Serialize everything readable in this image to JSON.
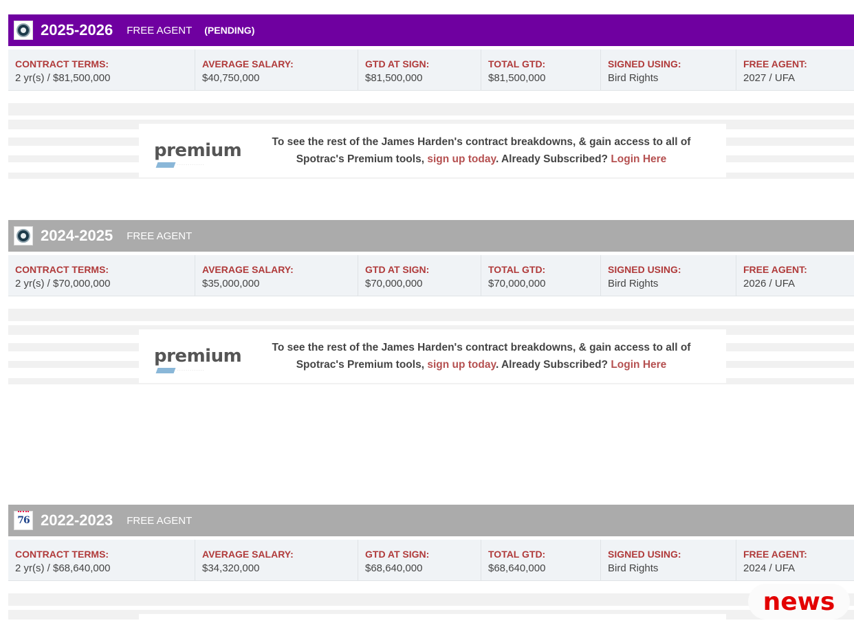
{
  "contracts": [
    {
      "season": "2025-2026",
      "status": "FREE AGENT",
      "pending": "(PENDING)",
      "team_logo": "team-logo-icon",
      "terms": [
        {
          "label": "CONTRACT TERMS:",
          "value": "2 yr(s) / $81,500,000"
        },
        {
          "label": "AVERAGE SALARY:",
          "value": "$40,750,000"
        },
        {
          "label": "GTD AT SIGN:",
          "value": "$81,500,000"
        },
        {
          "label": "TOTAL GTD:",
          "value": "$81,500,000"
        },
        {
          "label": "SIGNED USING:",
          "value": "Bird Rights"
        },
        {
          "label": "FREE AGENT:",
          "value": "2027 / UFA"
        }
      ]
    },
    {
      "season": "2024-2025",
      "status": "FREE AGENT",
      "team_logo": "team-logo-icon",
      "terms": [
        {
          "label": "CONTRACT TERMS:",
          "value": "2 yr(s) / $70,000,000"
        },
        {
          "label": "AVERAGE SALARY:",
          "value": "$35,000,000"
        },
        {
          "label": "GTD AT SIGN:",
          "value": "$70,000,000"
        },
        {
          "label": "TOTAL GTD:",
          "value": "$70,000,000"
        },
        {
          "label": "SIGNED USING:",
          "value": "Bird Rights"
        },
        {
          "label": "FREE AGENT:",
          "value": "2026 / UFA"
        }
      ]
    },
    {
      "season": "2022-2023",
      "status": "FREE AGENT",
      "team_logo": "sixers-logo-icon",
      "team_logo_text": "76",
      "terms": [
        {
          "label": "CONTRACT TERMS:",
          "value": "2 yr(s) / $68,640,000"
        },
        {
          "label": "AVERAGE SALARY:",
          "value": "$34,320,000"
        },
        {
          "label": "GTD AT SIGN:",
          "value": "$68,640,000"
        },
        {
          "label": "TOTAL GTD:",
          "value": "$68,640,000"
        },
        {
          "label": "SIGNED USING:",
          "value": "Bird Rights"
        },
        {
          "label": "FREE AGENT:",
          "value": "2024 / UFA"
        }
      ]
    }
  ],
  "promo": {
    "logo_text": "premium",
    "line1": "To see the rest of the James Harden's contract breakdowns, & gain access to all of",
    "line2_start": "Spotrac's Premium tools, ",
    "signup_link": "sign up today",
    "line2_mid": ". Already Subscribed? ",
    "login_link": "Login Here"
  },
  "watermark": "news",
  "colors": {
    "header_active": "#6f00a0",
    "header_inactive": "#ababab",
    "label_red": "#b03a3a",
    "link_red": "#b55050",
    "watermark_red": "#e30000"
  }
}
